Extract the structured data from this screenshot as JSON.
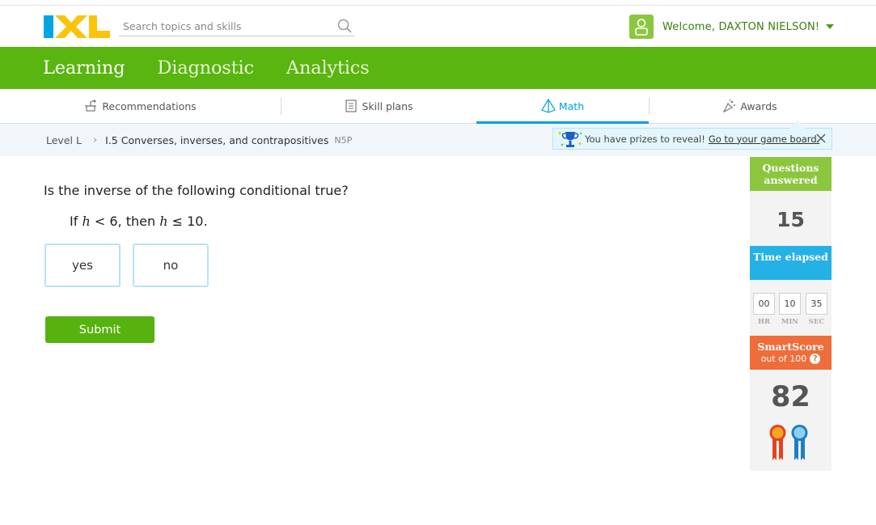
{
  "header": {
    "logo_text": "IXL",
    "search_placeholder": "Search topics and skills",
    "welcome": "Welcome, DAXTON NIELSON!"
  },
  "mainnav": [
    "Learning",
    "Diagnostic",
    "Analytics"
  ],
  "subnav": {
    "recommendations": "Recommendations",
    "skill_plans": "Skill plans",
    "math": "Math",
    "awards": "Awards"
  },
  "breadcrumb": {
    "level": "Level L",
    "skill": "I.5 Converses, inverses, and contrapositives",
    "code": "N5P"
  },
  "prize": {
    "message": "You have prizes to reveal!",
    "link": "Go to your game board."
  },
  "question": {
    "prompt": "Is the inverse of the following conditional true?",
    "conditional": {
      "if": "If",
      "var1": "h",
      "rel1": "< 6, then",
      "var2": "h",
      "rel2": "≤ 10."
    },
    "choices": [
      "yes",
      "no"
    ],
    "submit": "Submit"
  },
  "sidebar": {
    "questions_answered_label": "Questions answered",
    "questions_answered": "15",
    "time_elapsed_label": "Time elapsed",
    "time": {
      "hr": "00",
      "min": "10",
      "sec": "35"
    },
    "time_units": {
      "hr": "HR",
      "min": "MIN",
      "sec": "SEC"
    },
    "smartscore_label": "SmartScore",
    "smartscore_sub": "out of 100",
    "smartscore": "82"
  },
  "colors": {
    "green": "#59b50f",
    "blue": "#00a0e0",
    "orange": "#ef6d3a",
    "light_green": "#8cc63e"
  }
}
